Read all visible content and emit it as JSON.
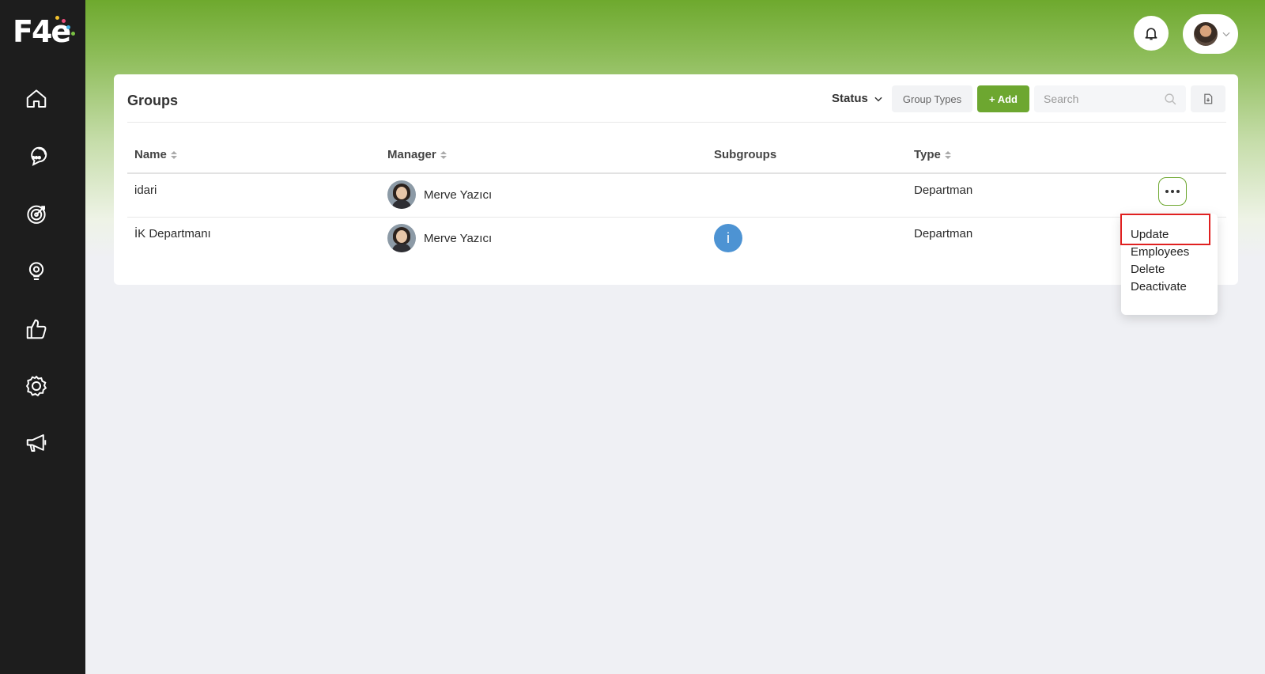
{
  "brand": {
    "logo_text": "F4e",
    "dot_colors": [
      "#f2c12e",
      "#e94b7a",
      "#3fb0e6",
      "#7ac143"
    ]
  },
  "colors": {
    "accent": "#6da730",
    "sidebar": "#1d1d1d",
    "badge": "#4d93d3",
    "highlight": "#e02020"
  },
  "sidebar": {
    "items": [
      {
        "icon": "home-icon"
      },
      {
        "icon": "chat-bubbles-icon"
      },
      {
        "icon": "target-icon"
      },
      {
        "icon": "lightbulb-icon"
      },
      {
        "icon": "thumbs-up-icon"
      },
      {
        "icon": "settings-icon"
      },
      {
        "icon": "megaphone-icon"
      }
    ]
  },
  "header": {
    "bell_icon": "bell-icon",
    "profile_icon": "user-avatar",
    "profile_chevron": "chevron-down-icon"
  },
  "card": {
    "title": "Groups",
    "toolbar": {
      "status_label": "Status",
      "group_types_label": "Group Types",
      "add_label": "+ Add",
      "search_placeholder": "Search",
      "export_icon": "file-export-icon"
    },
    "columns": [
      "Name",
      "Manager",
      "Subgroups",
      "Type"
    ],
    "rows": [
      {
        "name": "idari",
        "manager": "Merve Yazıcı",
        "subgroups": "",
        "type": "Departman"
      },
      {
        "name": "İK Departmanı",
        "manager": "Merve Yazıcı",
        "subgroups": "i",
        "type": "Departman"
      }
    ]
  },
  "row_menu": {
    "items": [
      "Update",
      "Employees",
      "Delete",
      "Deactivate"
    ]
  }
}
